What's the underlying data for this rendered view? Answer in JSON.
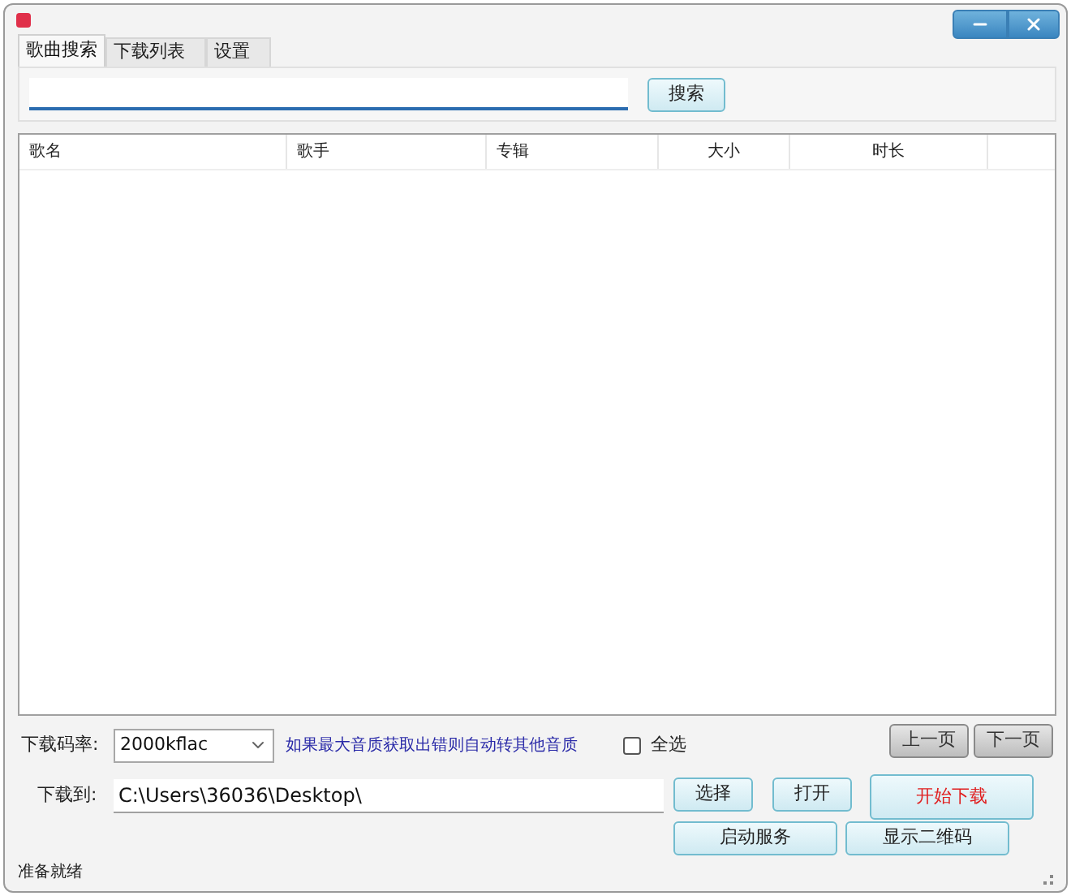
{
  "tabs": [
    {
      "label": "歌曲搜索",
      "selected": true
    },
    {
      "label": "下载列表",
      "selected": false
    },
    {
      "label": "设置",
      "selected": false
    }
  ],
  "search": {
    "button": "搜索"
  },
  "table": {
    "columns": [
      "歌名",
      "歌手",
      "专辑",
      "大小",
      "时长"
    ]
  },
  "bitrate": {
    "label": "下载码率:",
    "value": "2000kflac",
    "hint": "如果最大音质获取出错则自动转其他音质"
  },
  "select_all": {
    "label": "全选",
    "checked": false
  },
  "pager": [
    "上一页",
    "下一页"
  ],
  "download_to": {
    "label": "下载到:",
    "value": "C:\\Users\\36036\\Desktop\\"
  },
  "path_buttons": [
    "选择",
    "打开"
  ],
  "start_button": "开始下载",
  "service_buttons": [
    "启动服务",
    "显示二维码"
  ],
  "status_bar": "准备就绪"
}
